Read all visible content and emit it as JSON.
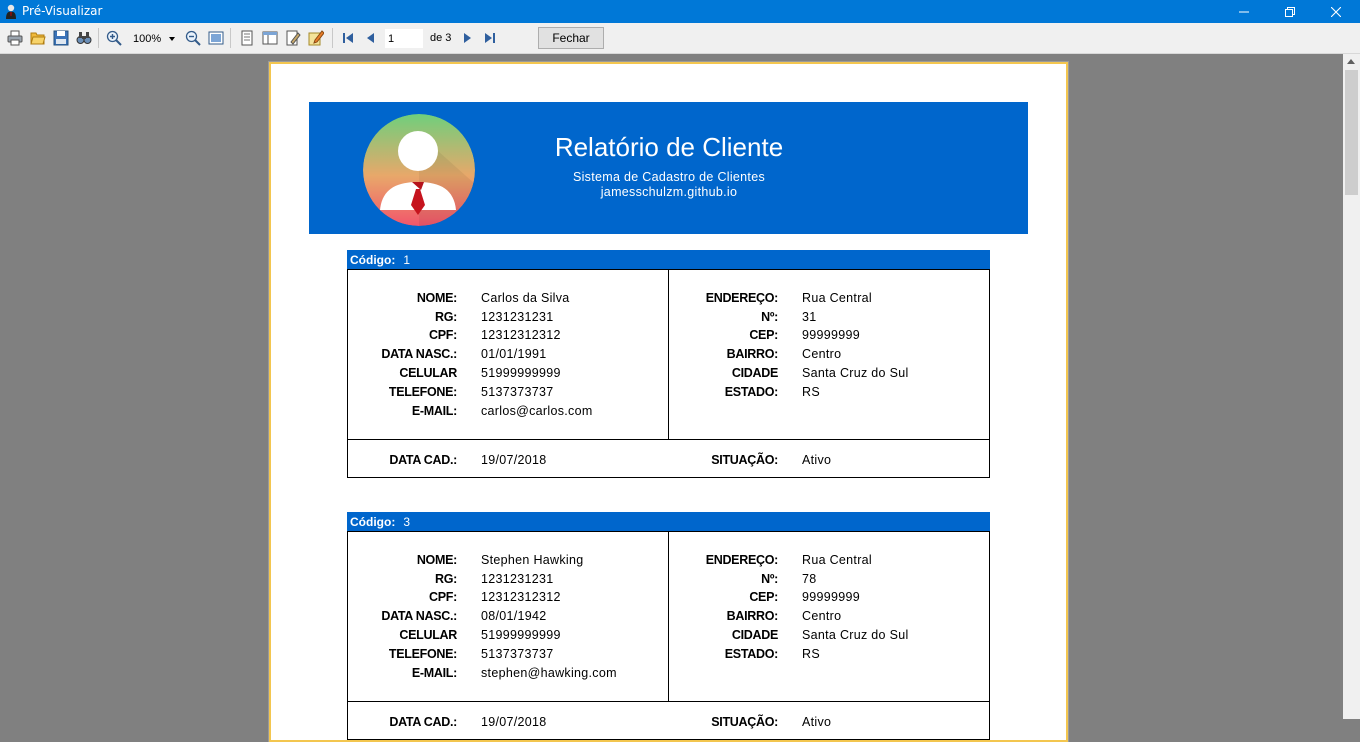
{
  "window": {
    "title": "Pré-Visualizar"
  },
  "toolbar": {
    "zoom": "100%",
    "page_current": "1",
    "page_total_label": "de 3",
    "close_label": "Fechar",
    "icons": [
      "print-icon",
      "open-icon",
      "save-icon",
      "find-icon",
      "zoom-in-icon",
      "zoom-out-icon",
      "page-width-icon",
      "single-page-icon",
      "two-page-icon",
      "edit-page-icon",
      "page-setup-icon",
      "first-page-icon",
      "prev-page-icon",
      "next-page-icon",
      "last-page-icon"
    ]
  },
  "report": {
    "title": "Relatório de Cliente",
    "subtitle": "Sistema de Cadastro de Clientes",
    "website": "jamesschulzm.github.io",
    "colors": {
      "band": "#0066cc",
      "border": "#f3c64f"
    }
  },
  "labels": {
    "code": "Código:",
    "name": "NOME:",
    "rg": "RG:",
    "cpf": "CPF:",
    "birth": "DATA NASC.:",
    "cell": "CELULAR",
    "phone": "TELEFONE:",
    "email": "E-MAIL:",
    "address": "ENDEREÇO:",
    "number": "Nº:",
    "zip": "CEP:",
    "district": "BAIRRO:",
    "city": "CIDADE",
    "state": "ESTADO:",
    "reg_date": "DATA CAD.:",
    "status": "SITUAÇÃO:"
  },
  "clients": [
    {
      "code": "1",
      "name": "Carlos da Silva",
      "rg": "1231231231",
      "cpf": "12312312312",
      "birth": "01/01/1991",
      "cell": "51999999999",
      "phone": "5137373737",
      "email": "carlos@carlos.com",
      "address": "Rua Central",
      "number": "31",
      "zip": "99999999",
      "district": "Centro",
      "city": "Santa Cruz do Sul",
      "state": "RS",
      "reg_date": "19/07/2018",
      "status": "Ativo"
    },
    {
      "code": "3",
      "name": "Stephen Hawking",
      "rg": "1231231231",
      "cpf": "12312312312",
      "birth": "08/01/1942",
      "cell": "51999999999",
      "phone": "5137373737",
      "email": "stephen@hawking.com",
      "address": "Rua Central",
      "number": "78",
      "zip": "99999999",
      "district": "Centro",
      "city": "Santa Cruz do Sul",
      "state": "RS",
      "reg_date": "19/07/2018",
      "status": "Ativo"
    }
  ]
}
